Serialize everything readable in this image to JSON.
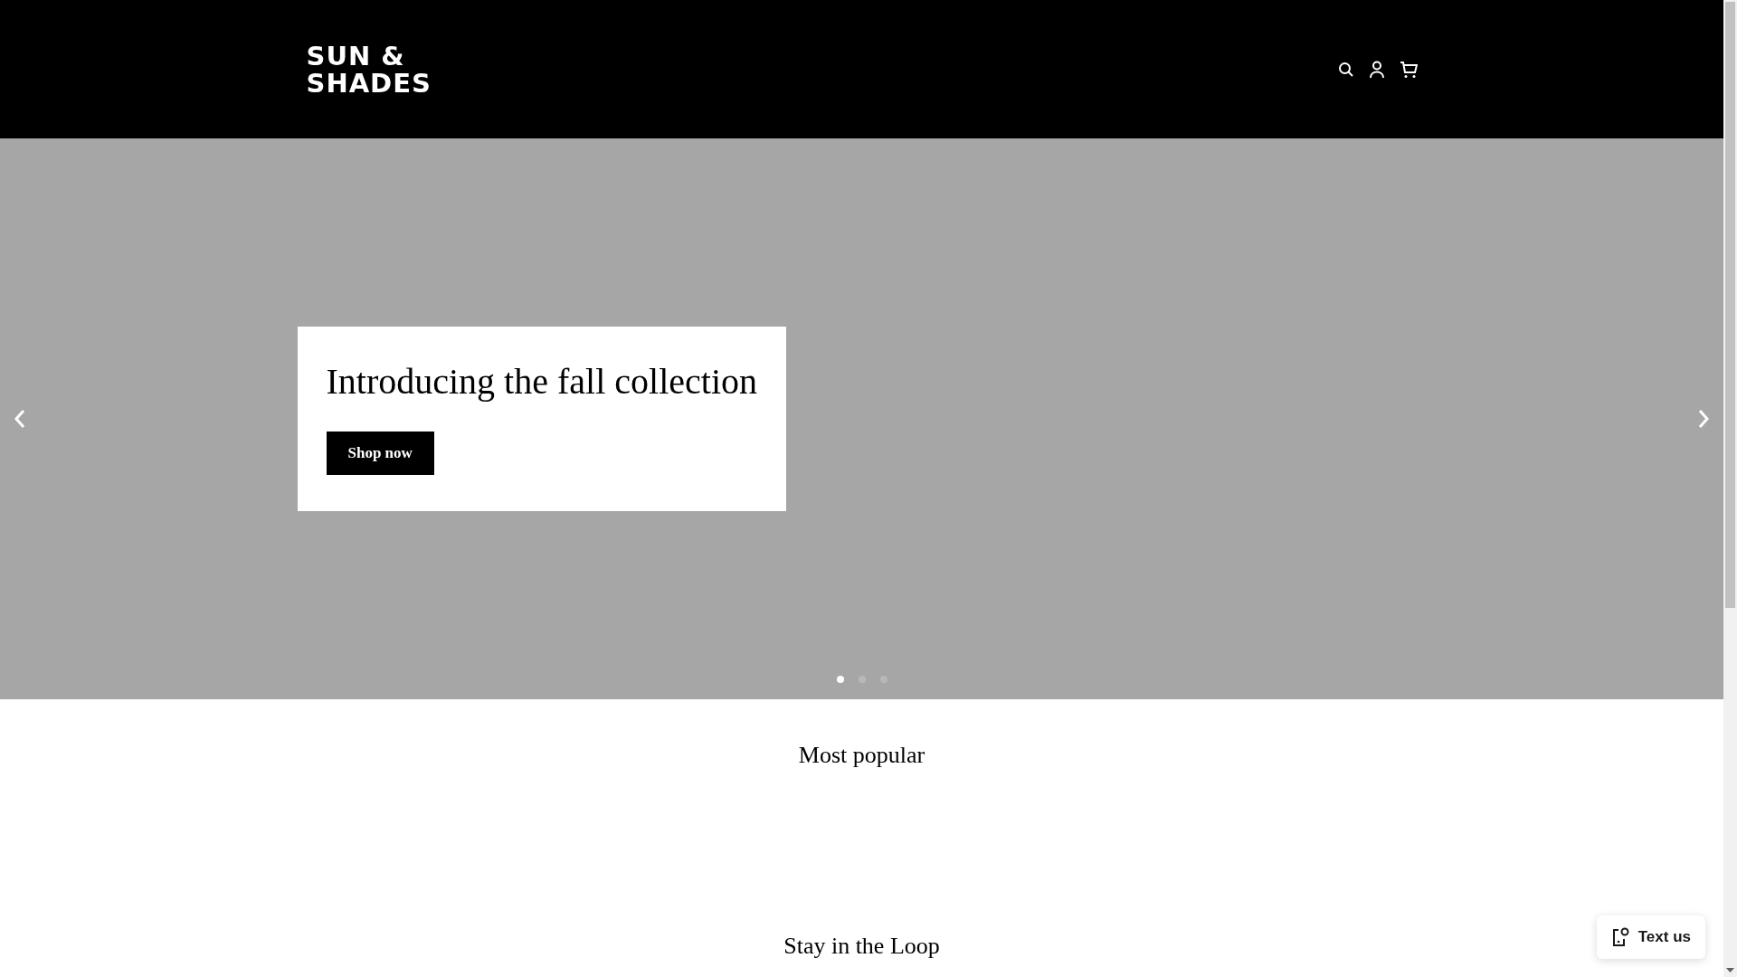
{
  "header": {
    "logo": [
      "SUN &",
      "SHADES"
    ]
  },
  "hero": {
    "title": "Introducing the fall collection",
    "button": "Shop now",
    "slides": [
      {
        "selected": true
      },
      {
        "selected": false
      },
      {
        "selected": false
      }
    ]
  },
  "sections": [
    {
      "title": "Most popular"
    },
    {
      "title": "Stay in the Loop"
    }
  ],
  "chat_button": {
    "label": "Text us"
  }
}
